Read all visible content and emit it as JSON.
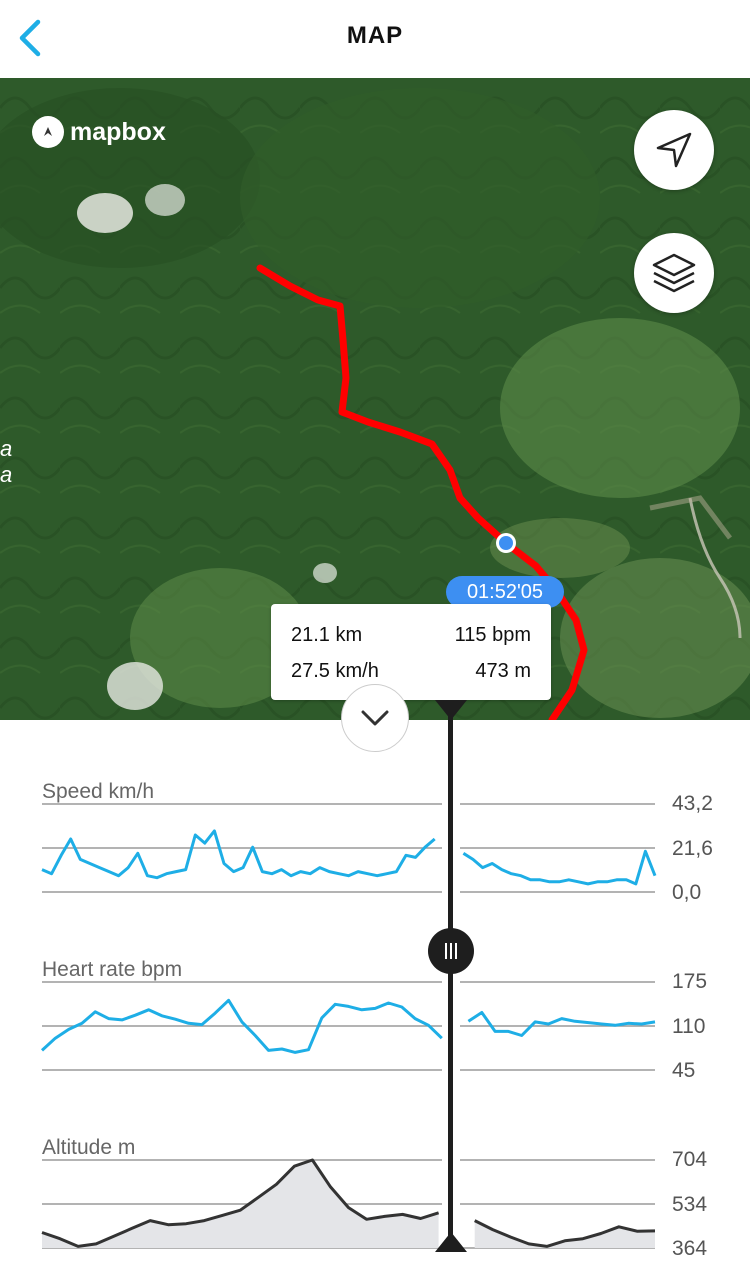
{
  "header": {
    "title": "MAP",
    "back_icon": "chevron-left-icon"
  },
  "map": {
    "attribution": "mapbox",
    "place_label_lines": [
      "a",
      "a"
    ],
    "route_color": "#ff0000",
    "locate_icon": "navigation-arrow-icon",
    "layers_icon": "layers-icon",
    "marker": {
      "time": "01:52'05",
      "distance": "21.1 km",
      "heart_rate": "115 bpm",
      "speed": "27.5 km/h",
      "altitude": "473 m"
    }
  },
  "charts": {
    "collapse_icon": "chevron-down-icon",
    "line_color": "#1eaee6",
    "altitude_color": "#333333",
    "speed": {
      "label": "Speed km/h",
      "ticks": [
        "43,2",
        "21,6",
        "0,0"
      ]
    },
    "heart_rate": {
      "label": "Heart rate bpm",
      "ticks": [
        "175",
        "110",
        "45"
      ]
    },
    "altitude": {
      "label": "Altitude m",
      "ticks": [
        "704",
        "534",
        "364"
      ]
    }
  },
  "chart_data": [
    {
      "type": "line",
      "title": "Speed km/h",
      "ylim": [
        0,
        43.2
      ],
      "y_ticks": [
        0,
        21.6,
        43.2
      ],
      "series": [
        {
          "values": [
            11,
            9,
            18,
            26,
            16,
            14,
            12,
            10,
            8,
            12,
            19,
            8,
            7,
            9,
            10,
            11,
            28,
            24,
            30,
            14,
            10,
            12,
            22,
            10,
            9,
            11,
            8,
            10,
            9,
            12,
            10,
            9,
            8,
            10,
            9,
            8,
            9,
            10,
            18,
            17,
            22,
            26,
            24,
            20,
            19,
            16,
            12,
            14,
            11,
            9,
            8,
            6,
            6,
            5,
            5,
            6,
            5,
            4,
            5,
            5,
            6,
            6,
            4,
            20,
            8
          ]
        }
      ]
    },
    {
      "type": "line",
      "title": "Heart rate bpm",
      "ylim": [
        45,
        175
      ],
      "y_ticks": [
        45,
        110,
        175
      ],
      "series": [
        {
          "values": [
            74,
            92,
            105,
            114,
            131,
            121,
            119,
            126,
            134,
            125,
            120,
            114,
            112,
            129,
            148,
            116,
            96,
            74,
            76,
            71,
            75,
            122,
            142,
            139,
            134,
            136,
            144,
            138,
            121,
            111,
            92,
            114,
            117,
            130,
            102,
            102,
            96,
            116,
            113,
            121,
            117,
            115,
            113,
            111,
            114,
            113,
            116
          ]
        }
      ]
    },
    {
      "type": "area",
      "title": "Altitude m",
      "ylim": [
        364,
        704
      ],
      "y_ticks": [
        364,
        534,
        704
      ],
      "series": [
        {
          "values": [
            424,
            400,
            370,
            380,
            410,
            440,
            470,
            454,
            458,
            470,
            490,
            510,
            560,
            610,
            680,
            704,
            600,
            520,
            475,
            486,
            494,
            478,
            500,
            497,
            470,
            435,
            406,
            380,
            370,
            392,
            400,
            420,
            446,
            429,
            430
          ]
        }
      ]
    }
  ]
}
